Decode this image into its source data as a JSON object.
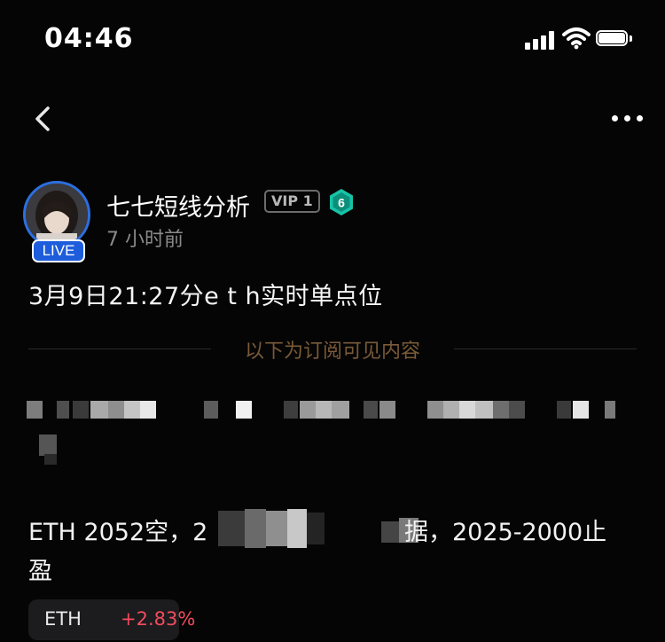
{
  "status_bar": {
    "time": "04:46"
  },
  "author": {
    "name": "七七短线分析",
    "vip": "VIP 1",
    "level": "6",
    "live_label": "LIVE",
    "posted": "7 小时前"
  },
  "post": {
    "title": "3月9日21:27分e t h实时单点位",
    "subscription_note": "以下为订阅可见内容",
    "body_prefix": "ETH 2052空，2",
    "body_suffix": "据，2025-2000止",
    "body_line2": "盈"
  },
  "ticker": {
    "symbol": "ETH",
    "change": "+2.83%",
    "change_color": "#f04b5e"
  },
  "colors": {
    "background": "#050505",
    "subscription_text": "#7a5a38",
    "live_badge": "#1d5ddc",
    "level_badge": "#17c3a7"
  },
  "icons": {
    "back": "chevron-left-icon",
    "more": "more-dots-icon",
    "signal": "cellular-signal-icon",
    "wifi": "wifi-icon",
    "battery": "battery-icon",
    "level": "hexagon-level-icon"
  }
}
